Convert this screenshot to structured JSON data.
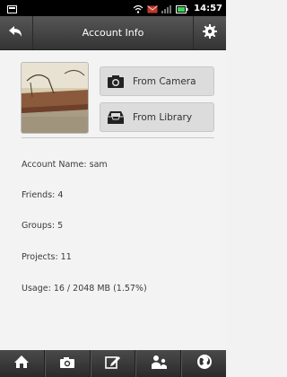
{
  "status_bar": {
    "time": "14:57",
    "icons": [
      "notification-icon",
      "wifi-icon",
      "mail-icon",
      "signal-icon",
      "battery-icon"
    ]
  },
  "header": {
    "title": "Account Info",
    "left_icon": "back-arrow-icon",
    "right_icon": "gear-icon"
  },
  "photo_actions": {
    "camera_label": "From Camera",
    "library_label": "From Library"
  },
  "account": {
    "name_line": "Account Name: sam",
    "friends_line": "Friends: 4",
    "groups_line": "Groups: 5",
    "projects_line": "Projects: 11",
    "usage_line": "Usage: 16 / 2048 MB (1.57%)"
  },
  "tab_bar": {
    "items": [
      "home-icon",
      "camera-icon",
      "edit-icon",
      "people-icon",
      "globe-icon"
    ]
  },
  "colors": {
    "header_bg": "#3f3f3f",
    "button_bg": "#dcdcdc",
    "page_bg": "#f3f3f3"
  }
}
